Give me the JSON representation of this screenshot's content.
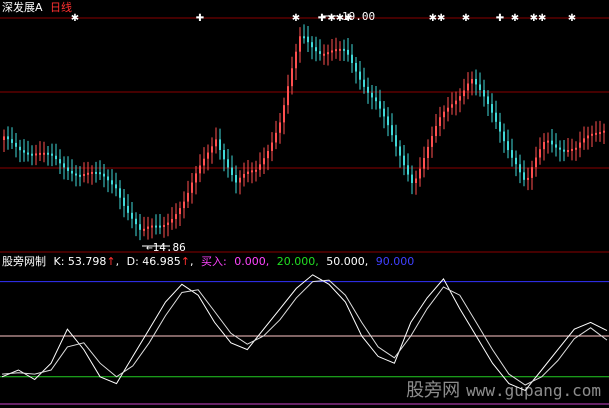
{
  "colors": {
    "background": "#000000",
    "divider": "#8a0000",
    "rise": "#ff5050",
    "fall": "#40d8d8",
    "k_line": "#ffffff",
    "d_line": "#dddddd",
    "level_90": "#3232ff",
    "level_50": "#ffc8c8",
    "level_20": "#22cc22",
    "level_0": "#cc44cc",
    "label_yellow": "#ffff00",
    "label_magenta": "#ff44ff",
    "label_green": "#22dd22",
    "label_blue": "#4040ff",
    "label_white": "#ffffff",
    "label_red": "#ff3030"
  },
  "main_header": {
    "symbol": "深发展A",
    "period": "日线"
  },
  "main_chart": {
    "high_label": "19.00",
    "low_label": "14.86",
    "signal_marks": [
      "✱",
      "✚",
      "✱",
      "✚",
      "✱✱✱",
      "✱✱",
      "✱",
      "✚",
      "✱",
      "✱✱",
      "✱"
    ]
  },
  "indicator_header": {
    "name": "股旁网制",
    "k_label": "K: 53.798",
    "d_label": "D: 46.985",
    "arrow": "↑",
    "buy_label": "买入:",
    "level_0": "0.000,",
    "level_20": "20.000,",
    "level_50": "50.000,",
    "level_90": "90.000"
  },
  "watermark": {
    "brand": "股旁网",
    "site": "www.gupang.com"
  },
  "chart_data": {
    "type": "line",
    "y_levels": [
      0,
      20,
      50,
      90
    ],
    "ylim": [
      0,
      100
    ],
    "series": [
      {
        "name": "K",
        "values": [
          20,
          25,
          18,
          30,
          55,
          40,
          20,
          15,
          35,
          55,
          75,
          88,
          80,
          60,
          45,
          40,
          55,
          70,
          85,
          95,
          88,
          75,
          50,
          35,
          30,
          60,
          78,
          92,
          70,
          50,
          30,
          15,
          10,
          25,
          40,
          55,
          60,
          54
        ]
      },
      {
        "name": "D",
        "values": [
          22,
          23,
          22,
          25,
          42,
          45,
          30,
          20,
          28,
          45,
          65,
          82,
          84,
          68,
          52,
          44,
          50,
          62,
          78,
          90,
          91,
          80,
          60,
          42,
          34,
          50,
          70,
          86,
          80,
          60,
          40,
          22,
          14,
          20,
          32,
          48,
          56,
          47
        ]
      }
    ]
  }
}
